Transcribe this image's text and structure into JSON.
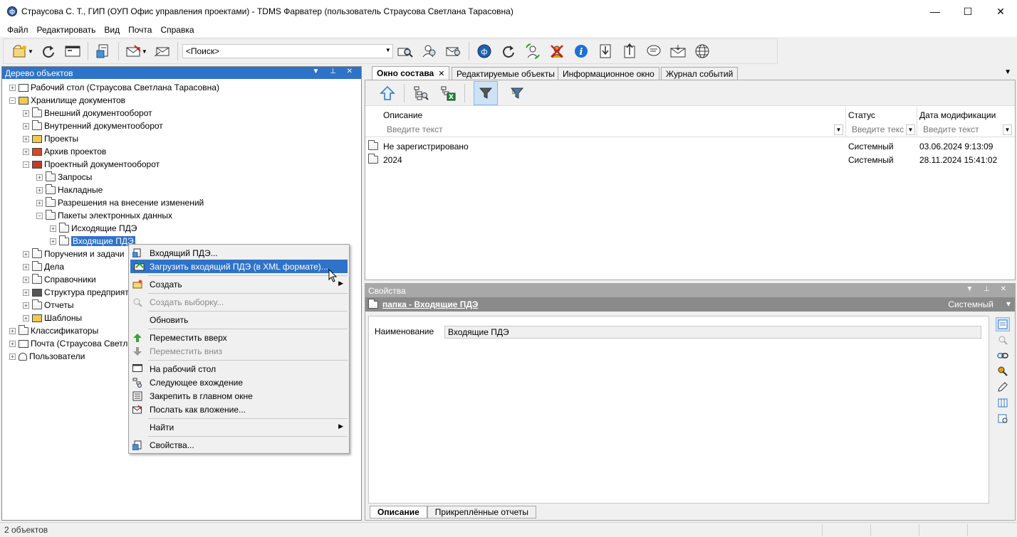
{
  "window": {
    "title": "Страусова С. Т., ГИП (ОУП Офис управления проектами) - TDMS Фарватер (пользователь Страусова Светлана Тарасовна)",
    "minimize": "—",
    "maximize": "☐",
    "close": "✕"
  },
  "menubar": [
    "Файл",
    "Редактировать",
    "Вид",
    "Почта",
    "Справка"
  ],
  "toolbar": {
    "search_value": "<Поиск>"
  },
  "left_panel": {
    "title": "Дерево объектов",
    "tree": [
      {
        "label": "Рабочий стол (Страусова Светлана Тарасовна)",
        "depth": 0,
        "exp": "+"
      },
      {
        "label": "Хранилище документов",
        "depth": 0,
        "exp": "−"
      },
      {
        "label": "Внешний документооборот",
        "depth": 1,
        "exp": "+"
      },
      {
        "label": "Внутренний документооборот",
        "depth": 1,
        "exp": "+"
      },
      {
        "label": "Проекты",
        "depth": 1,
        "exp": "+"
      },
      {
        "label": "Архив проектов",
        "depth": 1,
        "exp": "+"
      },
      {
        "label": "Проектный документооборот",
        "depth": 1,
        "exp": "−"
      },
      {
        "label": "Запросы",
        "depth": 2,
        "exp": "+"
      },
      {
        "label": "Накладные",
        "depth": 2,
        "exp": "+"
      },
      {
        "label": "Разрешения на внесение изменений",
        "depth": 2,
        "exp": "+"
      },
      {
        "label": "Пакеты электронных данных",
        "depth": 2,
        "exp": "−"
      },
      {
        "label": "Исходящие ПДЭ",
        "depth": 3,
        "exp": "+"
      },
      {
        "label": "Входящие ПДЭ",
        "depth": 3,
        "exp": "+",
        "selected": true
      },
      {
        "label": "Поручения и задачи",
        "depth": 1,
        "exp": "+"
      },
      {
        "label": "Дела",
        "depth": 1,
        "exp": "+"
      },
      {
        "label": "Справочники",
        "depth": 1,
        "exp": "+"
      },
      {
        "label": "Структура предприят",
        "depth": 1,
        "exp": "+"
      },
      {
        "label": "Отчеты",
        "depth": 1,
        "exp": "+"
      },
      {
        "label": "Шаблоны",
        "depth": 1,
        "exp": "+"
      },
      {
        "label": "Классификаторы",
        "depth": 0,
        "exp": "+"
      },
      {
        "label": "Почта (Страусова Светл",
        "depth": 0,
        "exp": "+"
      },
      {
        "label": "Пользователи",
        "depth": 0,
        "exp": "+"
      }
    ]
  },
  "context_menu": {
    "items": [
      {
        "label": "Входящий ПДЭ...",
        "icon": "new-document-icon"
      },
      {
        "label": "Загрузить входящий ПДЭ (в XML формате)...",
        "icon": "import-xml-icon",
        "highlighted": true
      },
      {
        "sep": true
      },
      {
        "label": "Создать",
        "icon": "create-icon",
        "submenu": true
      },
      {
        "sep": true
      },
      {
        "label": "Создать выборку...",
        "icon": "query-icon",
        "disabled": true
      },
      {
        "sep": true
      },
      {
        "label": "Обновить"
      },
      {
        "sep": true
      },
      {
        "label": "Переместить вверх",
        "icon": "arrow-up-icon"
      },
      {
        "label": "Переместить вниз",
        "icon": "arrow-down-icon",
        "disabled": true
      },
      {
        "sep": true
      },
      {
        "label": "На рабочий стол",
        "icon": "desktop-icon"
      },
      {
        "label": "Следующее вхождение",
        "icon": "next-occurrence-icon"
      },
      {
        "label": "Закрепить в главном окне",
        "icon": "pin-icon"
      },
      {
        "label": "Послать как вложение...",
        "icon": "send-attachment-icon"
      },
      {
        "sep": true
      },
      {
        "label": "Найти",
        "submenu": true
      },
      {
        "sep": true
      },
      {
        "label": "Свойства...",
        "icon": "properties-icon"
      }
    ]
  },
  "tabs": [
    {
      "label": "Окно состава",
      "active": true,
      "closable": true
    },
    {
      "label": "Редактируемые объекты"
    },
    {
      "label": "Информационное окно"
    },
    {
      "label": "Журнал событий"
    }
  ],
  "grid": {
    "columns": [
      {
        "title": "Описание",
        "filter": "Введите текст"
      },
      {
        "title": "Статус",
        "filter": "Введите текс"
      },
      {
        "title": "Дата модификации",
        "filter": "Введите текст"
      }
    ],
    "rows": [
      {
        "name": "Не зарегистрировано",
        "status": "Системный",
        "date": "03.06.2024 9:13:09"
      },
      {
        "name": "2024",
        "status": "Системный",
        "date": "28.11.2024 15:41:02"
      }
    ]
  },
  "properties": {
    "title": "Свойства",
    "object_link": "папка - Входящие ПДЭ",
    "status": "Системный",
    "field_label": "Наименование",
    "field_value": "Входящие ПДЭ",
    "tabs": [
      "Описание",
      "Прикреплённые отчеты"
    ]
  },
  "statusbar": {
    "text": "2 объектов"
  },
  "colors": {
    "accent": "#2f73c8",
    "panel_inactive": "#a8a8a8"
  }
}
